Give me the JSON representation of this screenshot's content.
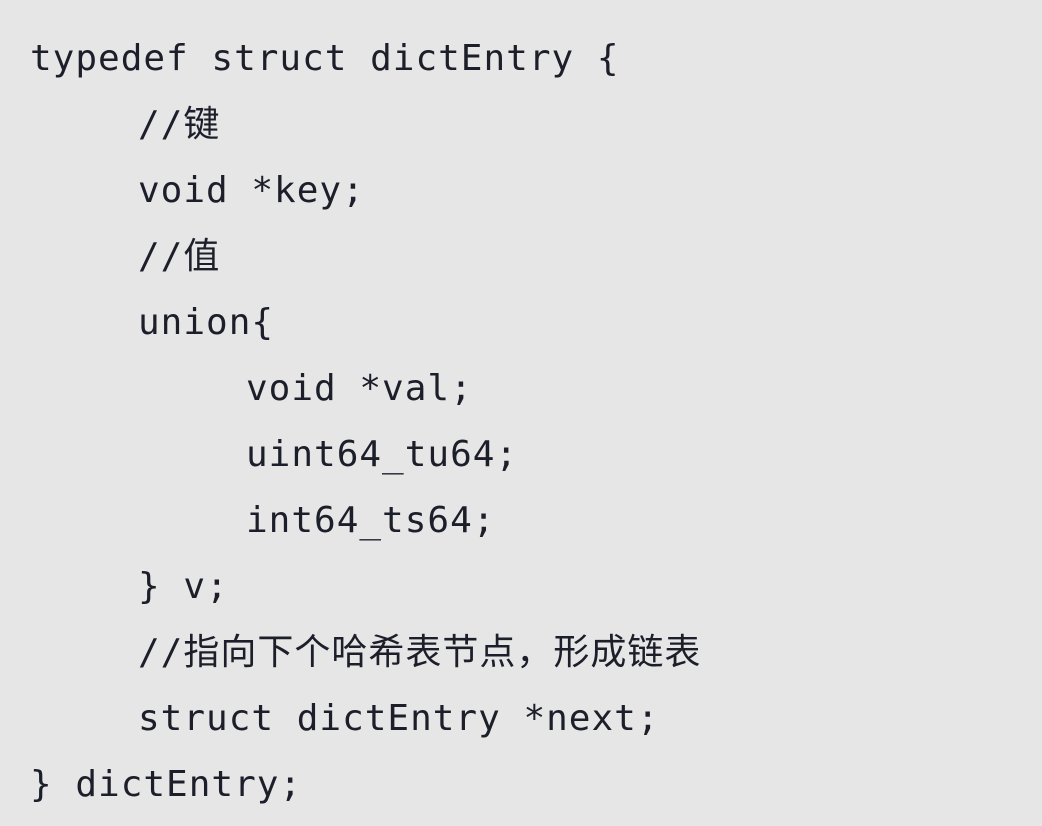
{
  "code": {
    "lines": [
      "typedef struct dictEntry {",
      "//键",
      "void *key;",
      "//值",
      "union{",
      "void *val;",
      "uint64_tu64;",
      "int64_ts64;",
      "} v;",
      "//指向下个哈希表节点，形成链表",
      "struct dictEntry *next;",
      "} dictEntry;"
    ]
  }
}
